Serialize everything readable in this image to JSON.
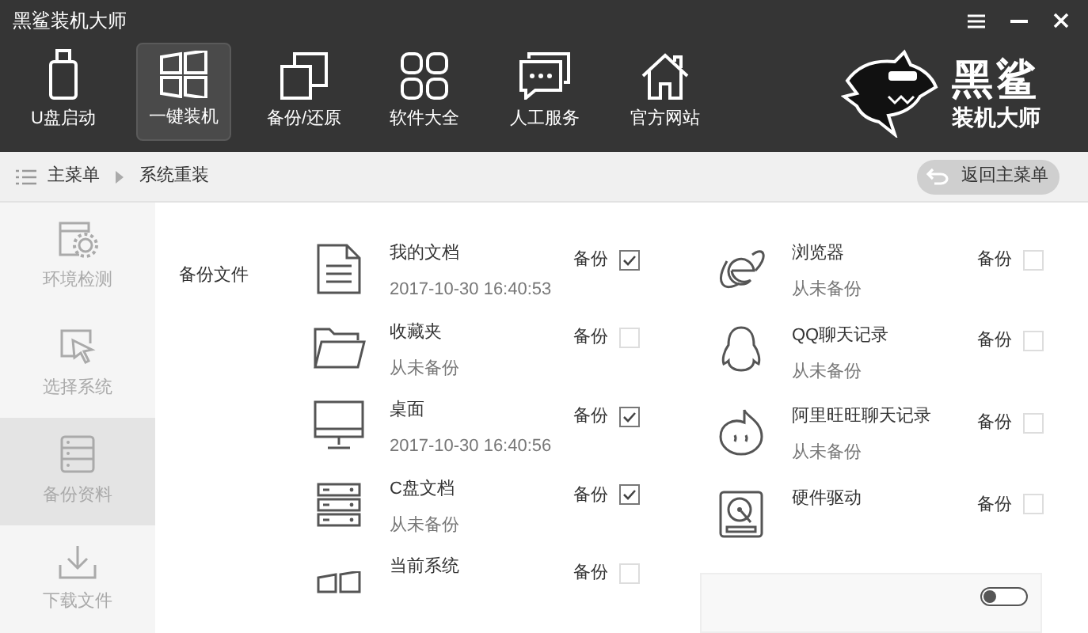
{
  "window": {
    "title": "黑鲨装机大师"
  },
  "nav": [
    {
      "label": "U盘启动",
      "selected": false
    },
    {
      "label": "一键装机",
      "selected": true
    },
    {
      "label": "备份/还原",
      "selected": false
    },
    {
      "label": "软件大全",
      "selected": false
    },
    {
      "label": "人工服务",
      "selected": false
    },
    {
      "label": "官方网站",
      "selected": false
    }
  ],
  "logo": {
    "line_1": "黑鲨",
    "line_2": "装机大师"
  },
  "breadcrumb": [
    "主菜单",
    "系统重装"
  ],
  "back_button": "返回主菜单",
  "steps": [
    {
      "label": "环境检测",
      "selected": false
    },
    {
      "label": "选择系统",
      "selected": false
    },
    {
      "label": "备份资料",
      "selected": true
    },
    {
      "label": "下载文件",
      "selected": false
    }
  ],
  "section_label": "备份文件",
  "left_items": [
    {
      "name": "我的文档",
      "status": "2017-10-30 16:40:53",
      "option": "备份",
      "checked": true
    },
    {
      "name": "收藏夹",
      "status": "从未备份",
      "option": "备份",
      "checked": false
    },
    {
      "name": "桌面",
      "status": "2017-10-30 16:40:56",
      "option": "备份",
      "checked": true
    },
    {
      "name": "C盘文档",
      "status": "从未备份",
      "option": "备份",
      "checked": true
    },
    {
      "name": "当前系统",
      "option": "备份",
      "checked": false
    }
  ],
  "right_items": [
    {
      "name": "浏览器",
      "status": "从未备份",
      "option": "备份",
      "checked": false
    },
    {
      "name": "QQ聊天记录",
      "status": "从未备份",
      "option": "备份",
      "checked": false
    },
    {
      "name": "阿里旺旺聊天记录",
      "status": "从未备份",
      "option": "备份",
      "checked": false
    },
    {
      "name": "硬件驱动",
      "option": "备份",
      "checked": false
    }
  ],
  "options_panel": {
    "toggle_on": false
  }
}
